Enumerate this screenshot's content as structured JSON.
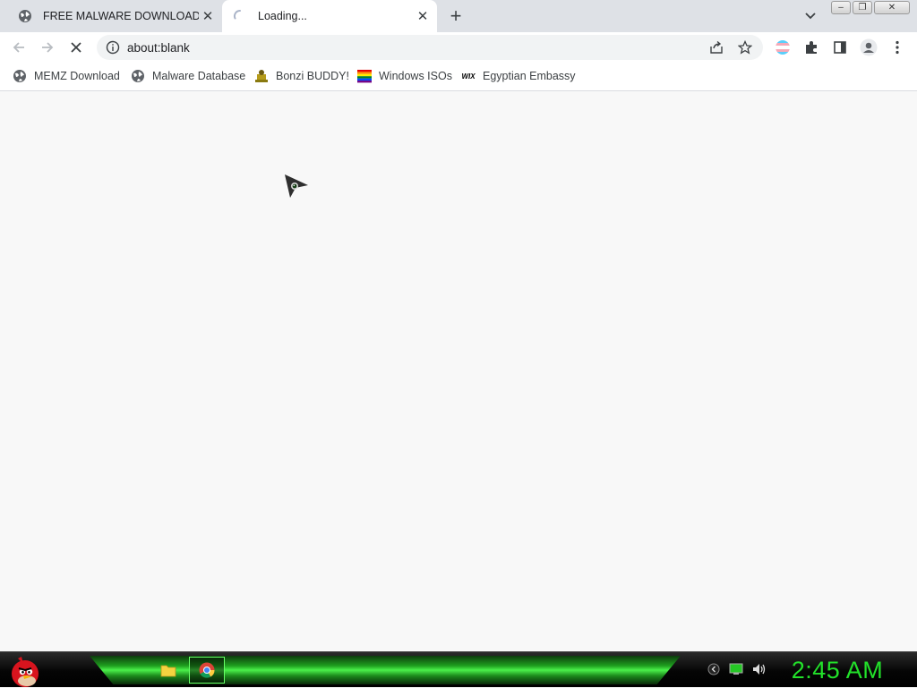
{
  "tabs": [
    {
      "title": "FREE MALWARE DOWNLOAD",
      "icon": "globe-icon",
      "close": "✕"
    },
    {
      "title": "Loading...",
      "icon": "loading-spinner-icon",
      "close": "✕"
    }
  ],
  "tabstrip": {
    "new_tab": "+",
    "tab_search": "chevron-down-icon"
  },
  "window_controls": {
    "minimize": "–",
    "restore": "❐",
    "close": "✕"
  },
  "toolbar": {
    "url": "about:blank",
    "back": "back-arrow-icon",
    "forward": "forward-arrow-icon",
    "stop": "stop-icon"
  },
  "bookmarks": [
    {
      "label": "MEMZ Download",
      "icon": "globe-icon"
    },
    {
      "label": "Malware Database",
      "icon": "globe-icon"
    },
    {
      "label": "Bonzi BUDDY!",
      "icon": "bonzi-icon"
    },
    {
      "label": "Windows ISOs",
      "icon": "rainbow-flag-icon"
    },
    {
      "label": "Egyptian Embassy",
      "icon": "wix-icon",
      "icon_text": "WIX"
    }
  ],
  "taskbar": {
    "clock": "2:45 AM",
    "accent_color": "#22e02a"
  }
}
